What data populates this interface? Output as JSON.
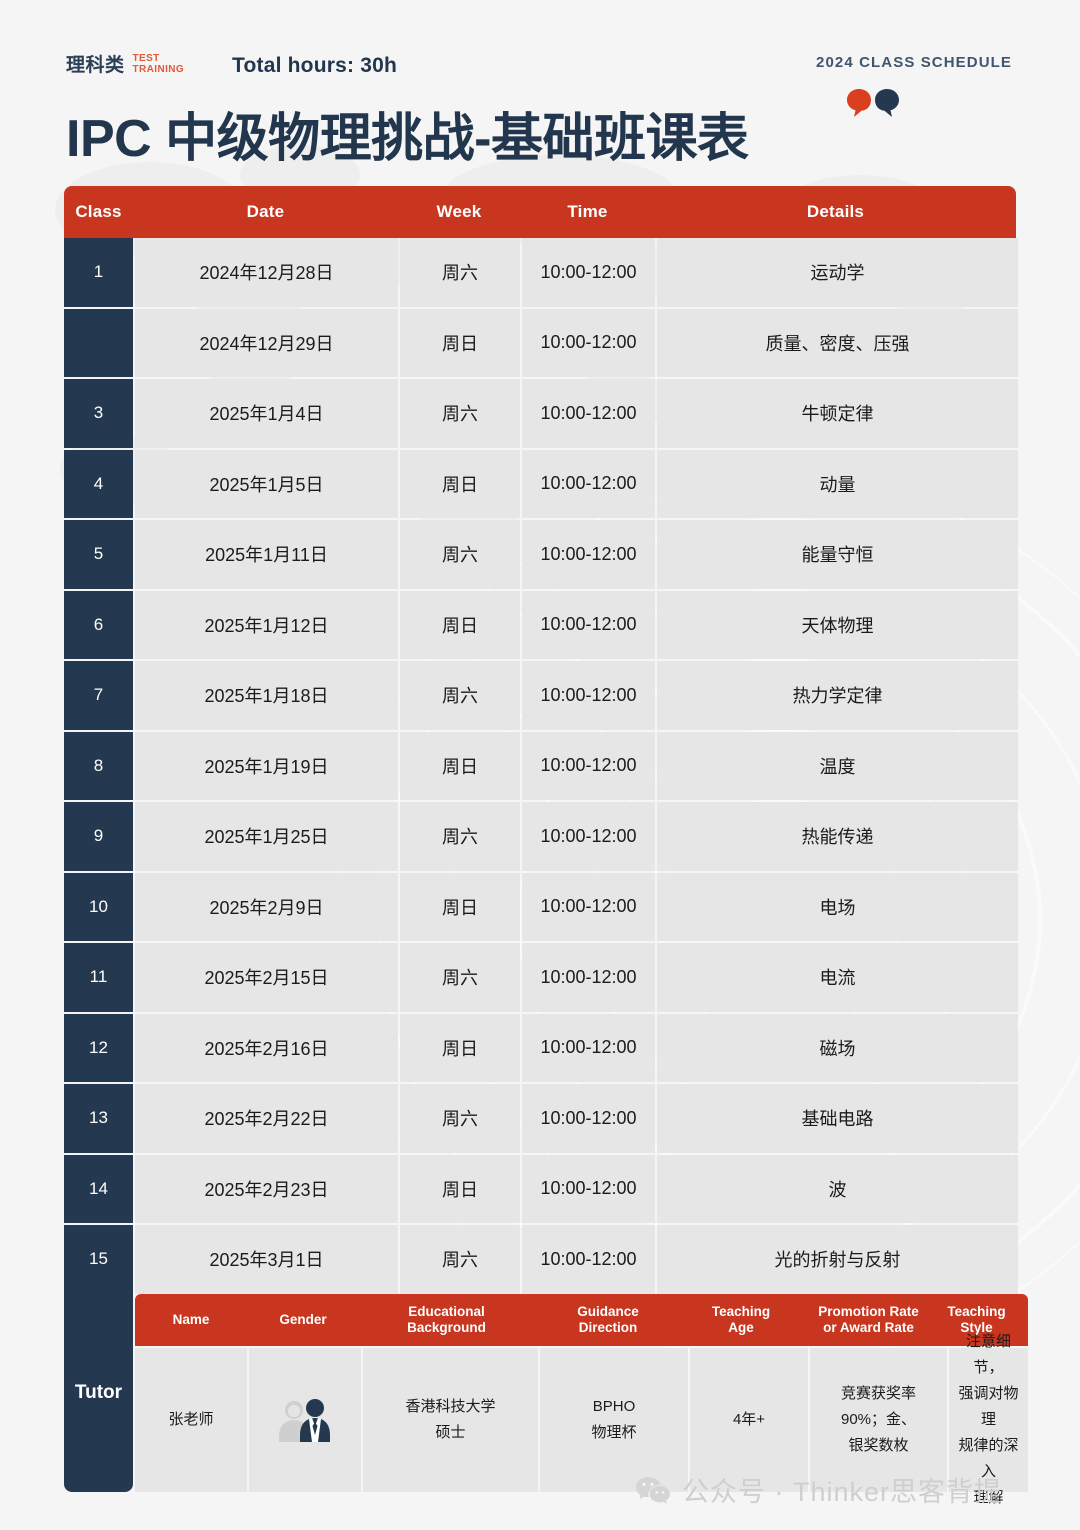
{
  "colors": {
    "accent_red": "#C8361F",
    "navy": "#24394F",
    "page_bg": "#F5F5F5",
    "cell_bg": "#E6E6E6",
    "logo_red": "#E05A3C"
  },
  "header": {
    "logo_cn": "理科类",
    "logo_en_line1": "TEST",
    "logo_en_line2": "TRAINING",
    "total_hours": "Total hours:  30h",
    "schedule_tag": "2024 CLASS SCHEDULE",
    "title": "IPC 中级物理挑战-基础班课表"
  },
  "schedule": {
    "columns": [
      "Class",
      "Date",
      "Week",
      "Time",
      "Details"
    ],
    "rows": [
      {
        "class": "1",
        "date": "2024年12月28日",
        "week": "周六",
        "time": "10:00-12:00",
        "details": "运动学"
      },
      {
        "class": "",
        "date": "2024年12月29日",
        "week": "周日",
        "time": "10:00-12:00",
        "details": "质量、密度、压强"
      },
      {
        "class": "3",
        "date": "2025年1月4日",
        "week": "周六",
        "time": "10:00-12:00",
        "details": "牛顿定律"
      },
      {
        "class": "4",
        "date": "2025年1月5日",
        "week": "周日",
        "time": "10:00-12:00",
        "details": "动量"
      },
      {
        "class": "5",
        "date": "2025年1月11日",
        "week": "周六",
        "time": "10:00-12:00",
        "details": "能量守恒"
      },
      {
        "class": "6",
        "date": "2025年1月12日",
        "week": "周日",
        "time": "10:00-12:00",
        "details": "天体物理"
      },
      {
        "class": "7",
        "date": "2025年1月18日",
        "week": "周六",
        "time": "10:00-12:00",
        "details": "热力学定律"
      },
      {
        "class": "8",
        "date": "2025年1月19日",
        "week": "周日",
        "time": "10:00-12:00",
        "details": "温度"
      },
      {
        "class": "9",
        "date": "2025年1月25日",
        "week": "周六",
        "time": "10:00-12:00",
        "details": "热能传递"
      },
      {
        "class": "10",
        "date": "2025年2月9日",
        "week": "周日",
        "time": "10:00-12:00",
        "details": "电场"
      },
      {
        "class": "11",
        "date": "2025年2月15日",
        "week": "周六",
        "time": "10:00-12:00",
        "details": "电流"
      },
      {
        "class": "12",
        "date": "2025年2月16日",
        "week": "周日",
        "time": "10:00-12:00",
        "details": "磁场"
      },
      {
        "class": "13",
        "date": "2025年2月22日",
        "week": "周六",
        "time": "10:00-12:00",
        "details": "基础电路"
      },
      {
        "class": "14",
        "date": "2025年2月23日",
        "week": "周日",
        "time": "10:00-12:00",
        "details": "波"
      },
      {
        "class": "15",
        "date": "2025年3月1日",
        "week": "周六",
        "time": "10:00-12:00",
        "details": "光的折射与反射"
      }
    ]
  },
  "tutor": {
    "row_label": "Tutor",
    "columns": {
      "name": "Name",
      "gender": "Gender",
      "education_line1": "Educational",
      "education_line2": "Background",
      "guidance_line1": "Guidance",
      "guidance_line2": "Direction",
      "teaching_age_line1": "Teaching",
      "teaching_age_line2": "Age",
      "promotion_line1": "Promotion Rate",
      "promotion_line2": "or Award Rate",
      "style_line1": "Teaching",
      "style_line2": "Style"
    },
    "values": {
      "name": "张老师",
      "gender_icon": "male-female-avatar-icon",
      "education": "香港科技大学\n硕士",
      "guidance": "BPHO\n物理杯",
      "teaching_age": "4年+",
      "promotion": "竞赛获奖率\n90%；金、\n银奖数枚",
      "style": "注意细节，\n强调对物理\n规律的深入\n理解"
    }
  },
  "watermark": {
    "text": "公众号 · Thinker思客背提"
  }
}
